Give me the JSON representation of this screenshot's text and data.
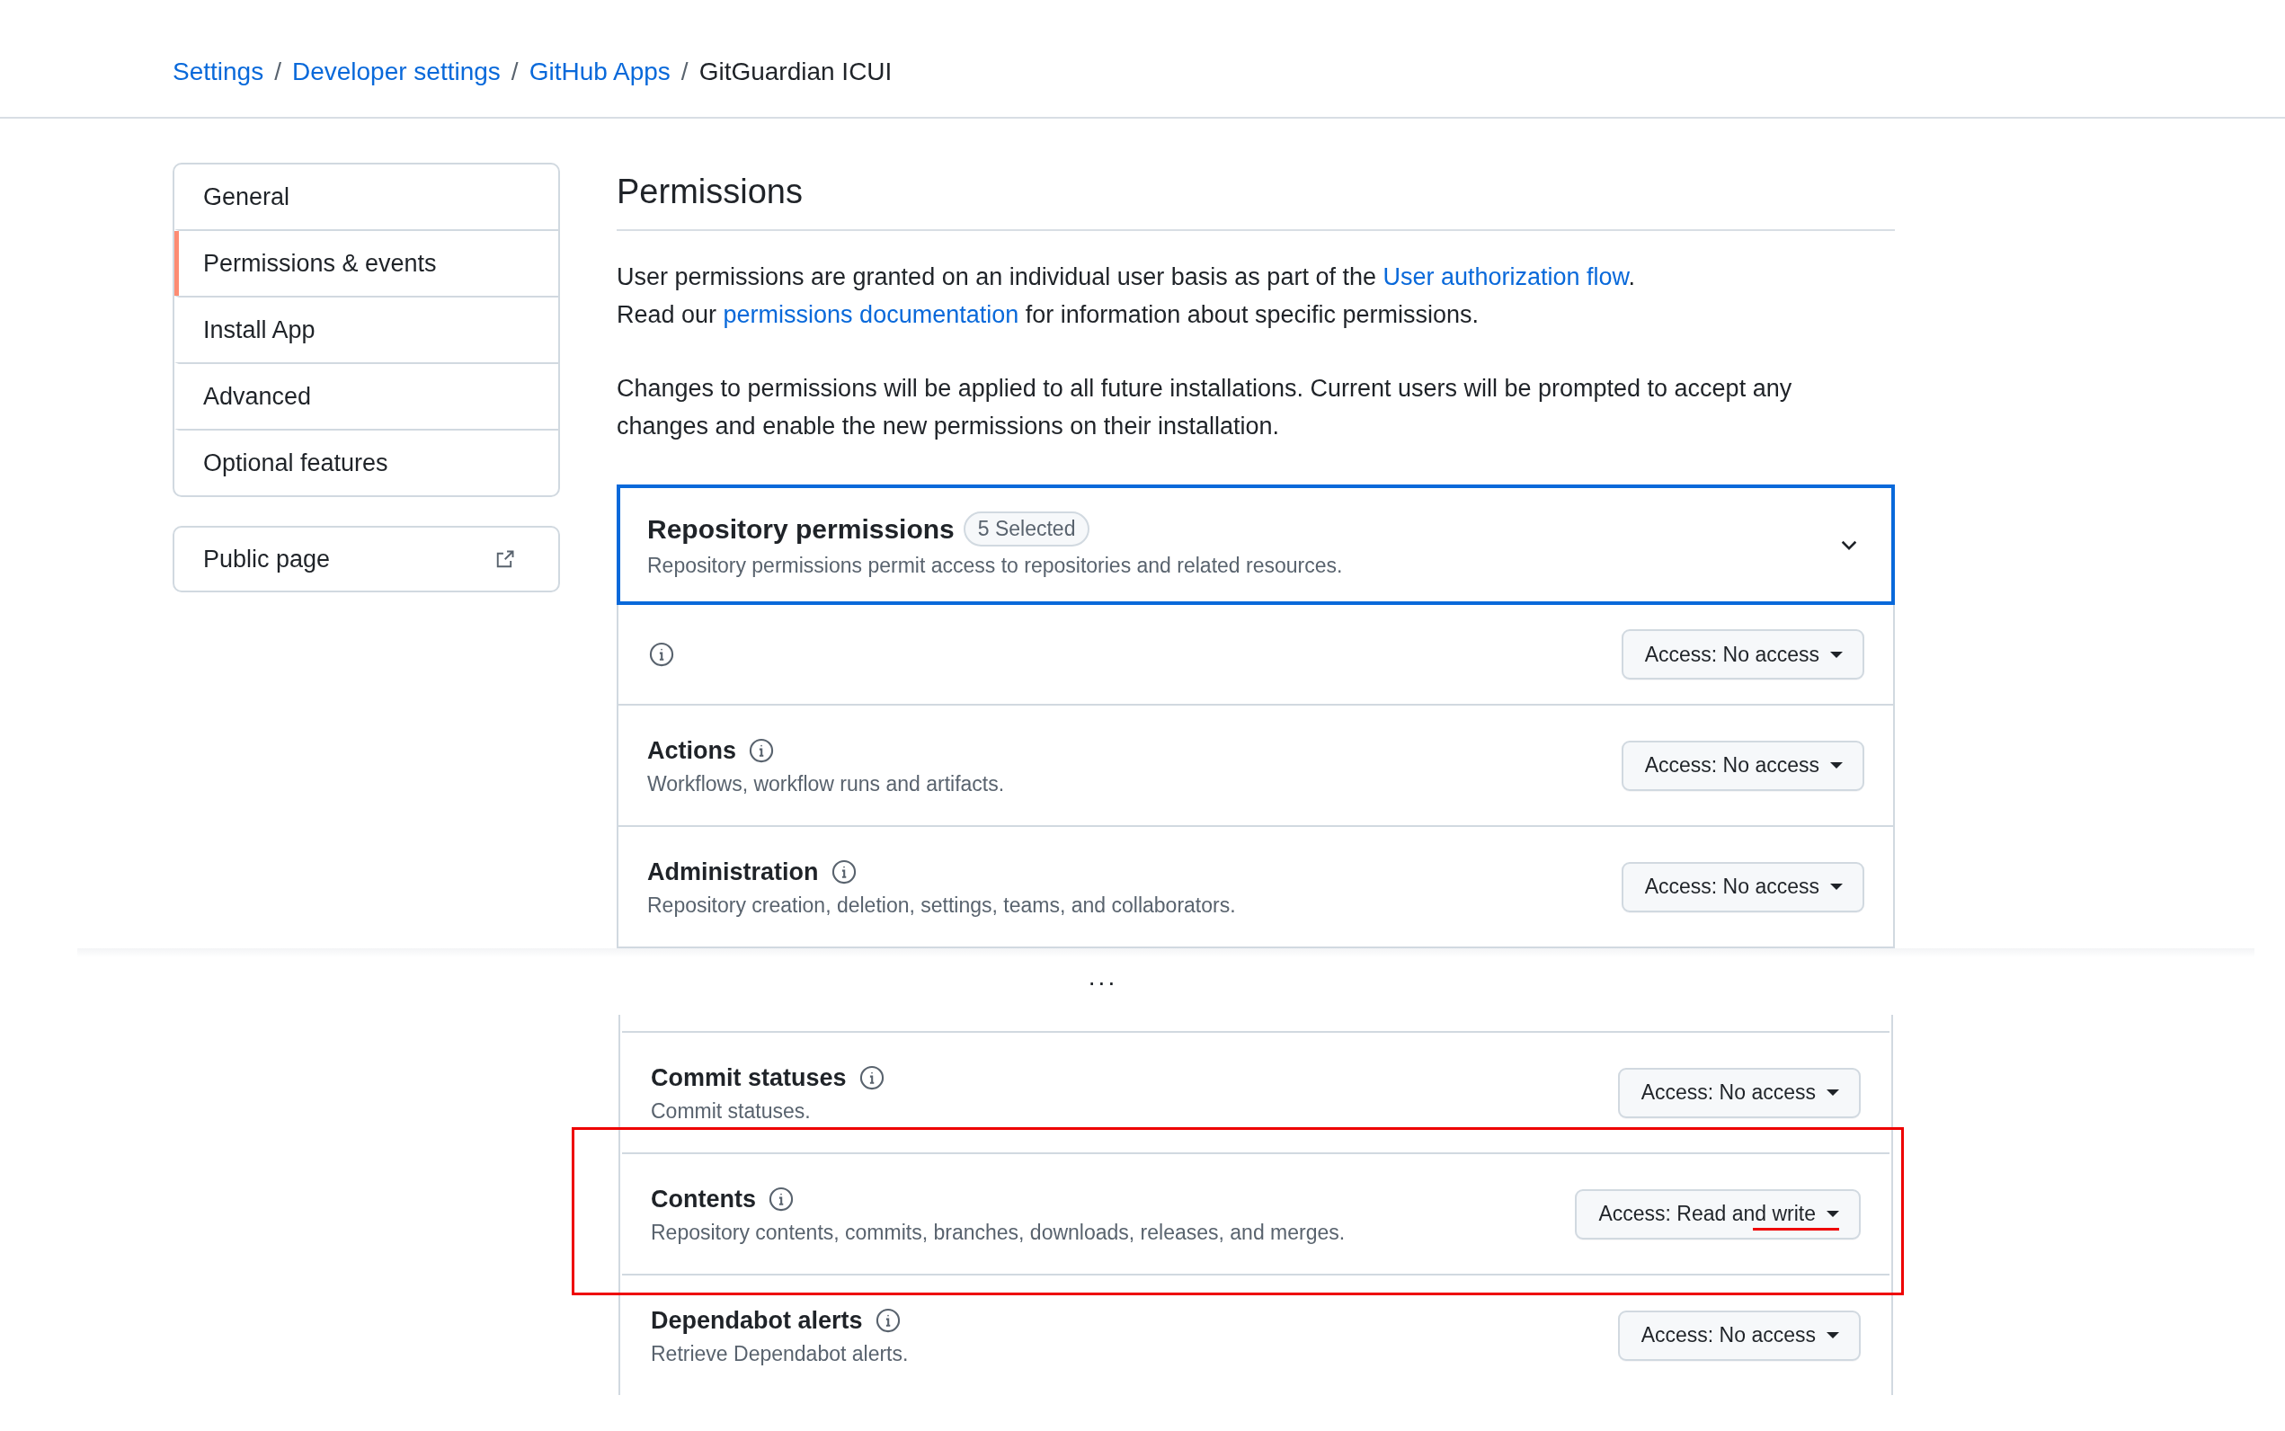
{
  "breadcrumb": {
    "links": [
      "Settings",
      "Developer settings",
      "GitHub Apps"
    ],
    "current": "GitGuardian ICUI"
  },
  "breadcrumb_separator": "/",
  "sidebar": {
    "items": [
      {
        "label": "General",
        "selected": false
      },
      {
        "label": "Permissions & events",
        "selected": true
      },
      {
        "label": "Install App",
        "selected": false
      },
      {
        "label": "Advanced",
        "selected": false
      },
      {
        "label": "Optional features",
        "selected": false
      }
    ],
    "public_page": {
      "label": "Public page"
    }
  },
  "heading": "Permissions",
  "intro": [
    {
      "before": "User permissions are granted on an individual user basis as part of the ",
      "link": "User authorization flow",
      "after": "."
    },
    {
      "before": "Read our ",
      "link": "permissions documentation",
      "after": " for information about specific permissions."
    }
  ],
  "notice": "Changes to permissions will be applied to all future installations. Current users will be prompted to accept any changes and enable the new permissions on their installation.",
  "repository_permissions": {
    "title": "Repository permissions",
    "badge": "5 Selected",
    "description": "Repository permissions permit access to repositories and related resources.",
    "expanded": true,
    "focused": true
  },
  "permission_rows_top": [
    {
      "access": "Access: No access",
      "highlighted": false
    },
    {
      "name": "Actions",
      "description": "Workflows, workflow runs and artifacts.",
      "access": "Access: No access",
      "highlighted": false
    },
    {
      "name": "Administration",
      "description": "Repository creation, deletion, settings, teams, and collaborators.",
      "access": "Access: No access",
      "highlighted": false
    }
  ],
  "gap_marker": "...",
  "permission_rows_bottom": [
    {
      "name": "Commit statuses",
      "description": "Commit statuses.",
      "access": "Access: No access",
      "highlighted": false
    },
    {
      "name": "Contents",
      "description": "Repository contents, commits, branches, downloads, releases, and merges.",
      "access": "Access: Read and write",
      "highlighted": true
    },
    {
      "name": "Dependabot alerts",
      "description": "Retrieve Dependabot alerts.",
      "access": "Access: No access",
      "highlighted": false
    }
  ]
}
